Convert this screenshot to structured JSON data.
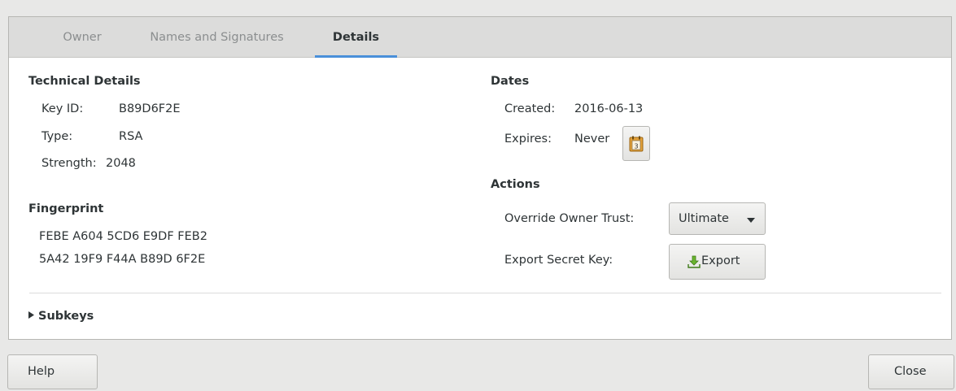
{
  "tabs": [
    "Owner",
    "Names and Signatures",
    "Details"
  ],
  "technical": {
    "heading": "Technical Details",
    "key_id_label": "Key ID:",
    "key_id": "B89D6F2E",
    "type_label": "Type:",
    "type": "RSA",
    "strength_label": "Strength:",
    "strength": "2048"
  },
  "fingerprint": {
    "heading": "Fingerprint",
    "line1": "FEBE A604 5CD6 E9DF FEB2",
    "line2": "5A42 19F9 F44A B89D 6F2E"
  },
  "dates": {
    "heading": "Dates",
    "created_label": "Created:",
    "created": "2016-06-13",
    "expires_label": "Expires:",
    "expires": "Never",
    "calendar_icon_number": "3"
  },
  "actions": {
    "heading": "Actions",
    "trust_label": "Override Owner Trust:",
    "trust_value": "Ultimate",
    "export_label": "Export Secret Key:",
    "export_button": "Export"
  },
  "subkeys": {
    "label": "Subkeys"
  },
  "footer": {
    "help": "Help",
    "close": "Close"
  },
  "colors": {
    "tab_underline": "#4a90d9",
    "export_icon": "#5aa12b",
    "calendar_icon": "#c58a2a"
  }
}
